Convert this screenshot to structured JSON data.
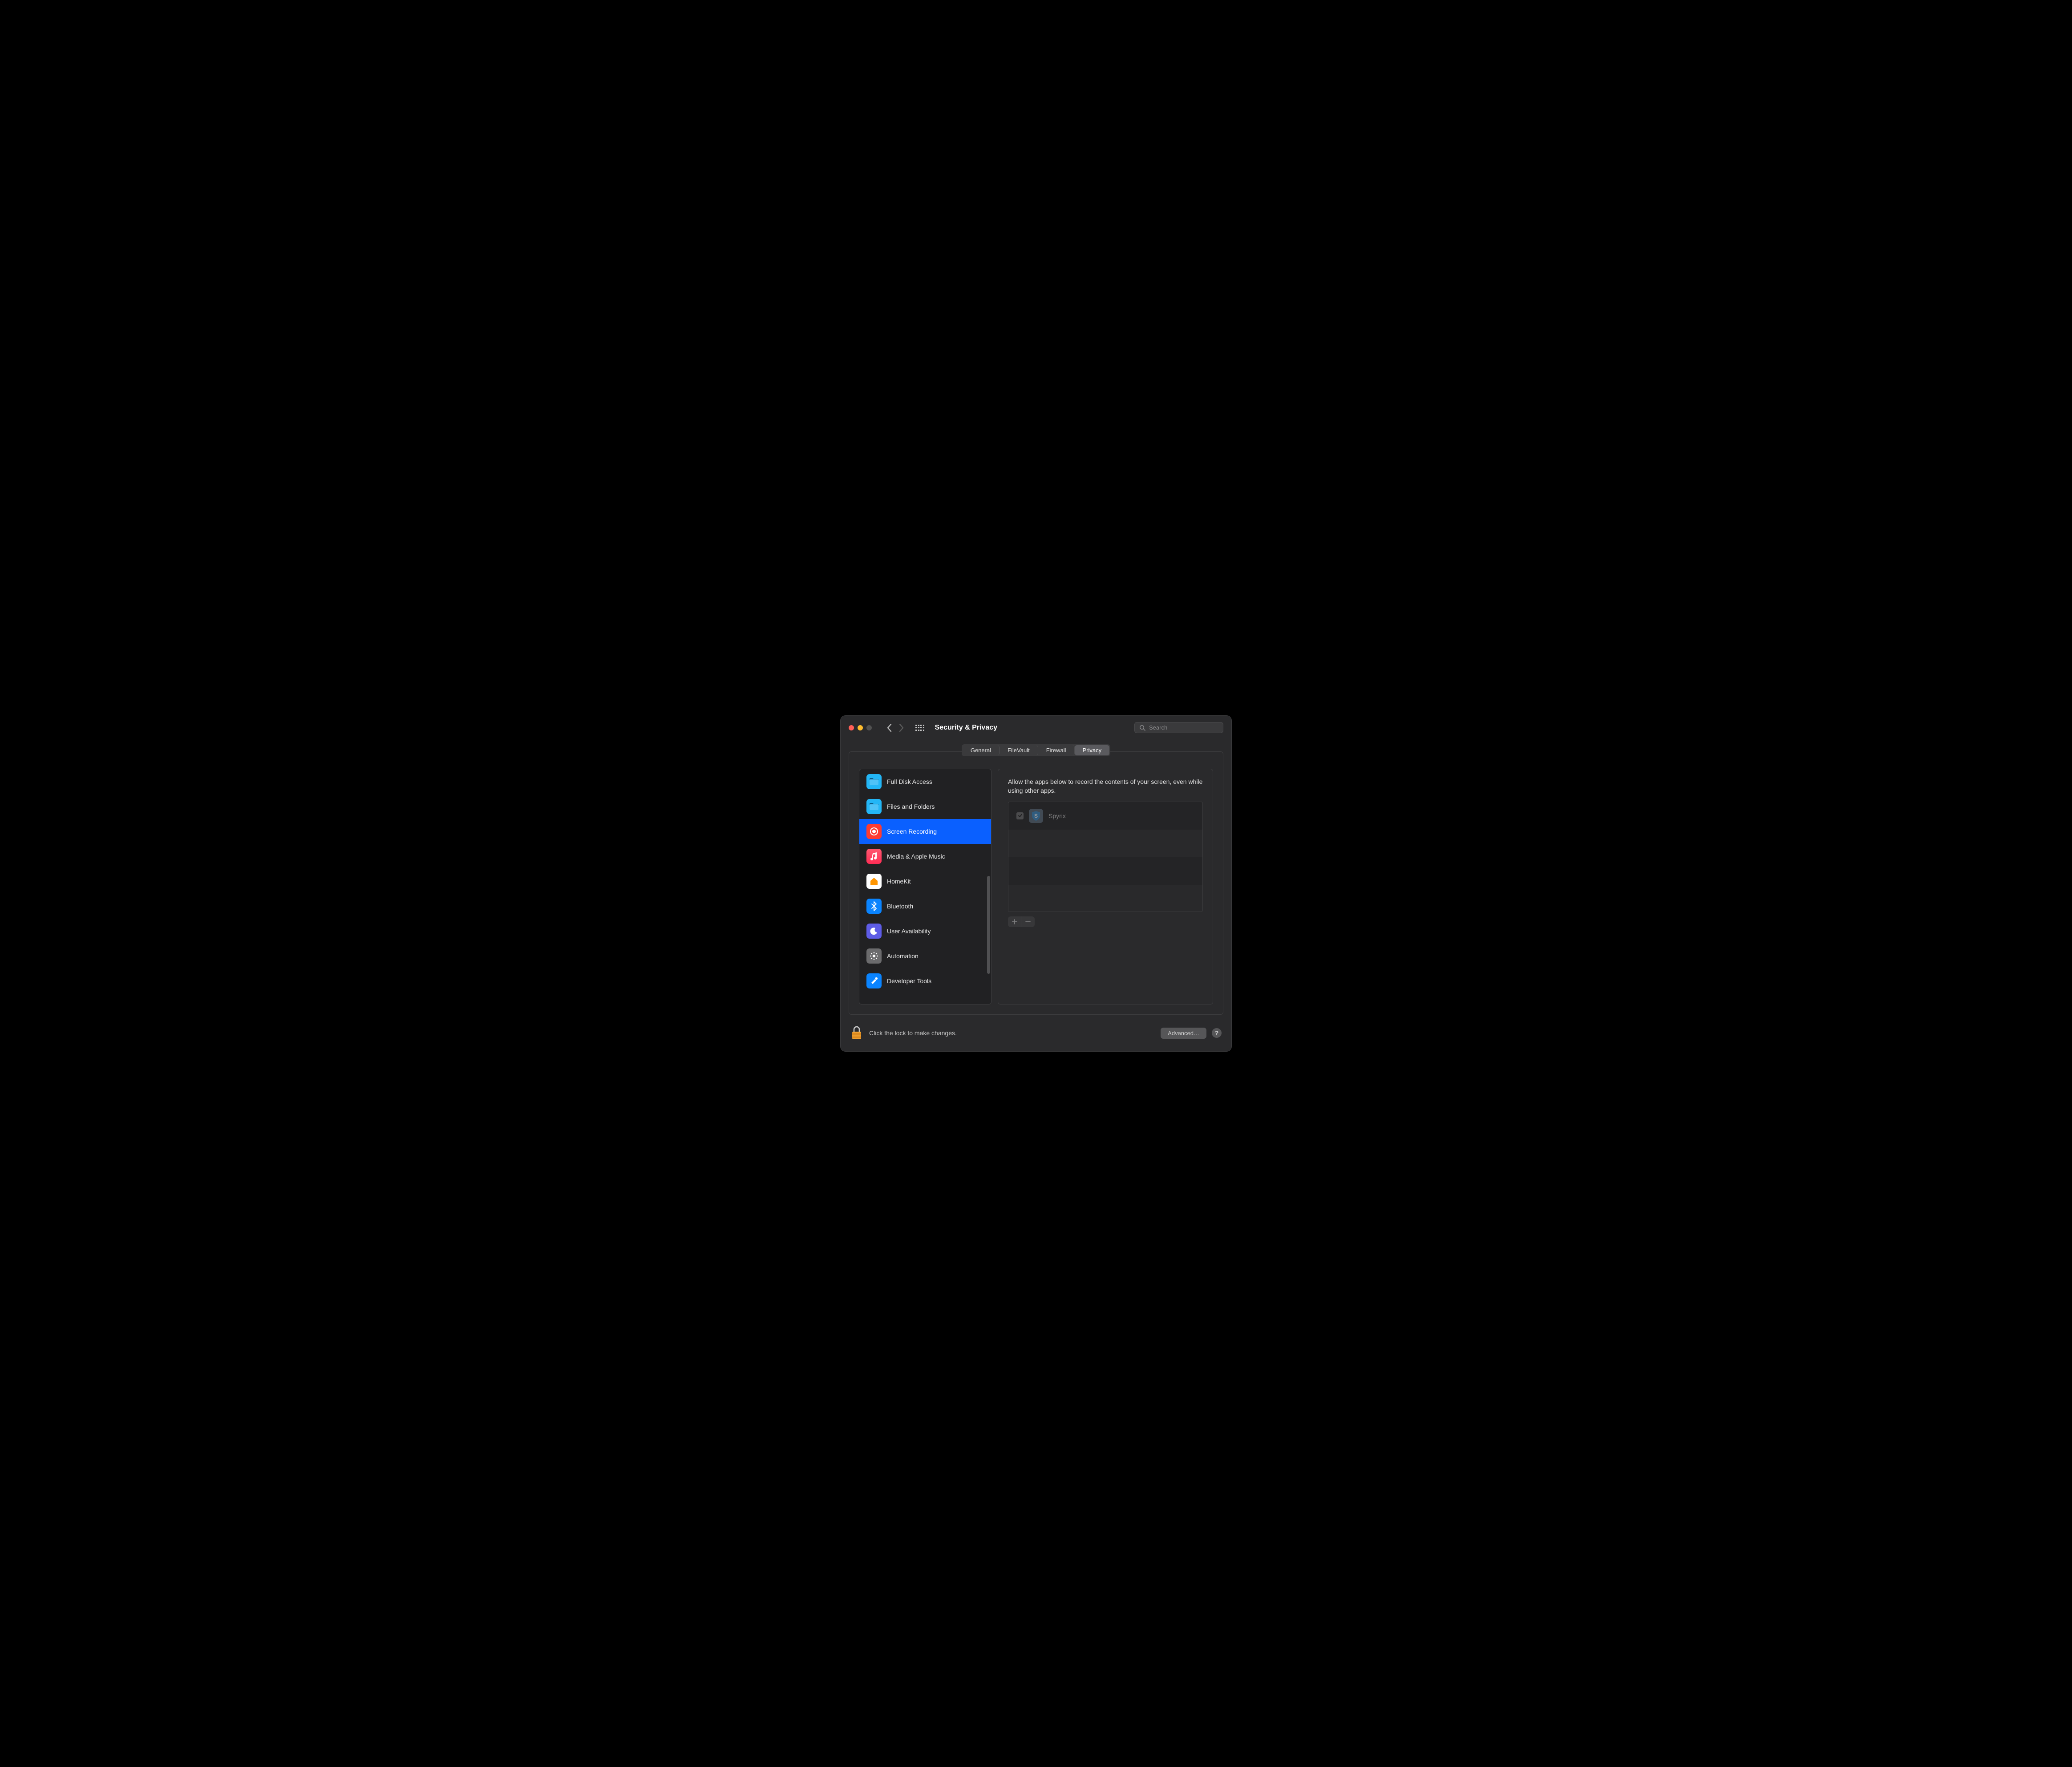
{
  "window": {
    "title": "Security & Privacy",
    "search_placeholder": "Search"
  },
  "tabs": [
    {
      "label": "General",
      "active": false
    },
    {
      "label": "FileVault",
      "active": false
    },
    {
      "label": "Firewall",
      "active": false
    },
    {
      "label": "Privacy",
      "active": true
    }
  ],
  "sidebar": {
    "items": [
      {
        "id": "full-disk-access",
        "label": "Full Disk Access",
        "icon": "folder",
        "bg": "#23b6f6",
        "selected": false
      },
      {
        "id": "files-and-folders",
        "label": "Files and Folders",
        "icon": "folder",
        "bg": "#23b6f6",
        "selected": false
      },
      {
        "id": "screen-recording",
        "label": "Screen Recording",
        "icon": "record",
        "bg": "#ff3b30",
        "selected": true
      },
      {
        "id": "media-apple-music",
        "label": "Media & Apple Music",
        "icon": "music",
        "bg": "#ff2d55",
        "selected": false
      },
      {
        "id": "homekit",
        "label": "HomeKit",
        "icon": "home",
        "bg": "#ffffff",
        "selected": false
      },
      {
        "id": "bluetooth",
        "label": "Bluetooth",
        "icon": "bluetooth",
        "bg": "#0a84ff",
        "selected": false
      },
      {
        "id": "user-availability",
        "label": "User Availability",
        "icon": "moon",
        "bg": "#5e5ce6",
        "selected": false
      },
      {
        "id": "automation",
        "label": "Automation",
        "icon": "gear",
        "bg": "#6b6b6d",
        "selected": false
      },
      {
        "id": "developer-tools",
        "label": "Developer Tools",
        "icon": "hammer",
        "bg": "#0a84ff",
        "selected": false
      }
    ]
  },
  "detail": {
    "description": "Allow the apps below to record the contents of your screen, even while using other apps.",
    "apps": [
      {
        "name": "Spyrix",
        "checked": true
      }
    ]
  },
  "footer": {
    "lock_text": "Click the lock to make changes.",
    "advanced_label": "Advanced…",
    "help_label": "?"
  }
}
